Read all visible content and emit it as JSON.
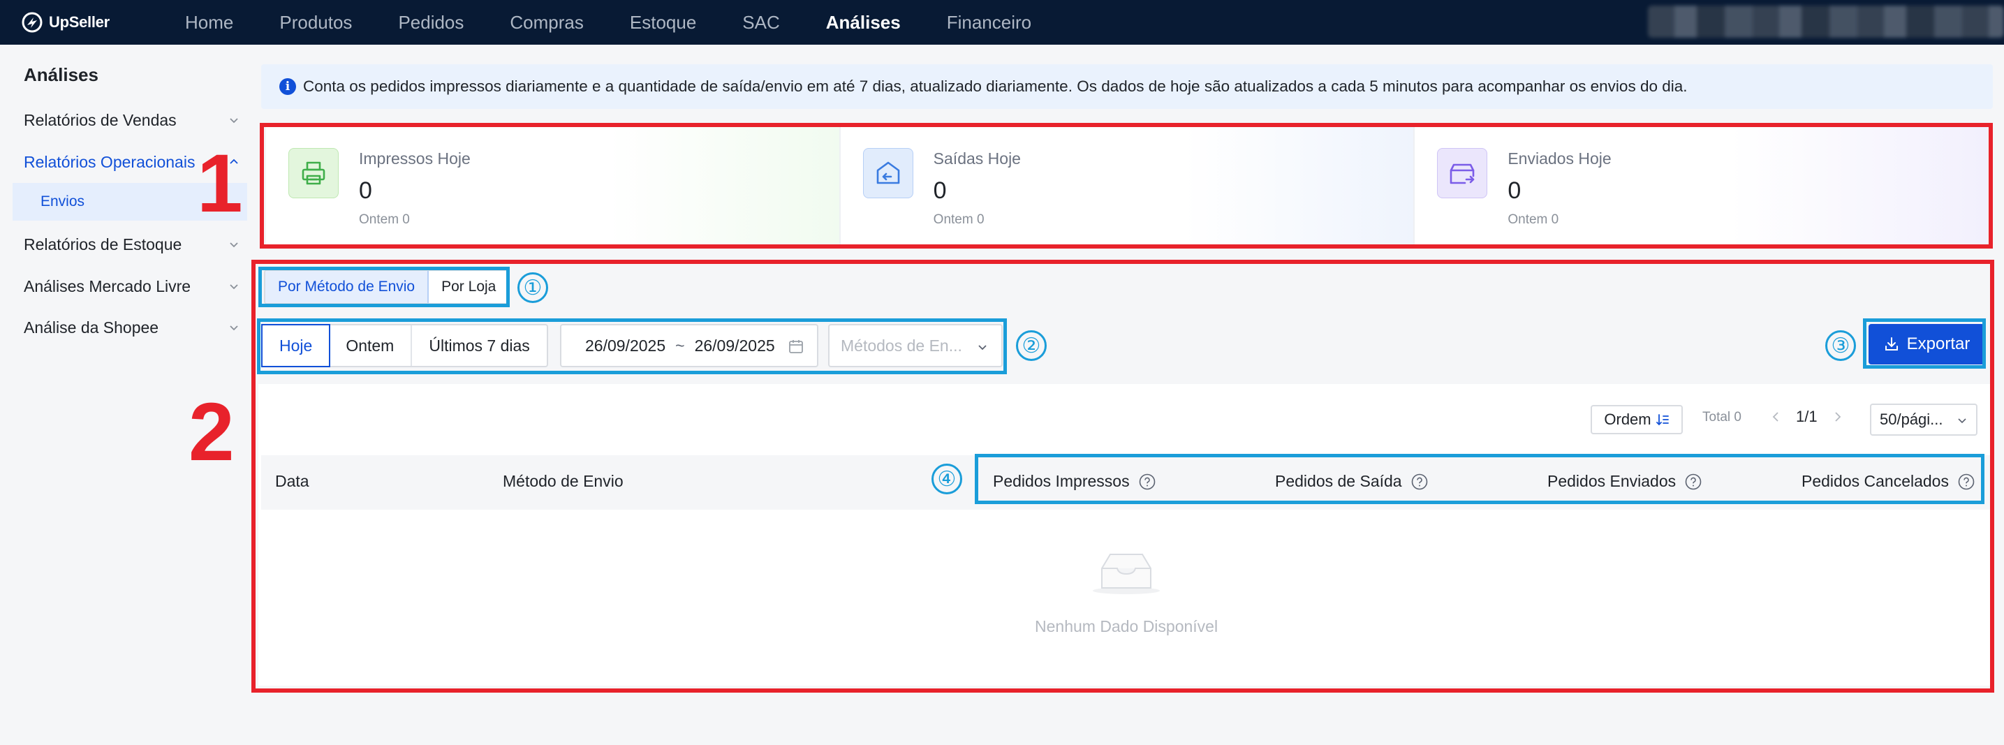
{
  "app": {
    "brand": "UpSeller"
  },
  "nav": {
    "items": [
      "Home",
      "Produtos",
      "Pedidos",
      "Compras",
      "Estoque",
      "SAC",
      "Análises",
      "Financeiro"
    ],
    "active": "Análises"
  },
  "sidebar": {
    "title": "Análises",
    "items": [
      {
        "label": "Relatórios de Vendas"
      },
      {
        "label": "Relatórios Operacionais"
      },
      {
        "label": "Relatórios de Estoque"
      },
      {
        "label": "Análises Mercado Livre"
      },
      {
        "label": "Análise da Shopee"
      }
    ],
    "sub_item": "Envios"
  },
  "banner": {
    "text": "Conta os pedidos impressos diariamente e a quantidade de saída/envio em até 7 dias, atualizado diariamente. Os dados de hoje são atualizados a cada 5 minutos para acompanhar os envios do dia."
  },
  "stats": [
    {
      "label": "Impressos Hoje",
      "value": "0",
      "sub": "Ontem 0",
      "icon": "printer-icon",
      "color": "#3fae4a"
    },
    {
      "label": "Saídas Hoje",
      "value": "0",
      "sub": "Ontem 0",
      "icon": "outbound-box-icon",
      "color": "#3a7be0"
    },
    {
      "label": "Enviados Hoje",
      "value": "0",
      "sub": "Ontem 0",
      "icon": "shipped-box-icon",
      "color": "#7b5ce8"
    }
  ],
  "group_by": {
    "options": [
      "Por Método de Envio",
      "Por Loja"
    ],
    "selected": "Por Método de Envio"
  },
  "date_filter": {
    "options": [
      "Hoje",
      "Ontem",
      "Últimos 7 dias"
    ],
    "selected": "Hoje",
    "start": "26/09/2025",
    "separator": "~",
    "end": "26/09/2025"
  },
  "shipping_select": {
    "placeholder": "Métodos de En..."
  },
  "export_label": "Exportar",
  "toolbar": {
    "order_label": "Ordem",
    "total": "Total 0",
    "page": "1/1",
    "page_size": "50/pági..."
  },
  "table": {
    "columns": [
      "Data",
      "Método de Envio",
      "Pedidos Impressos",
      "Pedidos de Saída",
      "Pedidos Enviados",
      "Pedidos Cancelados"
    ],
    "empty_text": "Nenhum Dado Disponível"
  },
  "annotations": {
    "big": [
      "1",
      "2"
    ],
    "circled": [
      "①",
      "②",
      "③",
      "④"
    ],
    "red": "#e8222b",
    "blue": "#1a9dd9"
  },
  "colors": {
    "primary": "#1150d8",
    "nav_bg": "#081a34"
  }
}
